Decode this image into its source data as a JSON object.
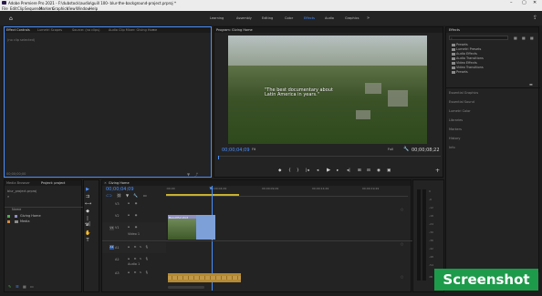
{
  "window": {
    "title": "Adobe Premiere Pro 2021 - F:\\dubstock\\audio\\guill 100- blur-the-background-project.prproj *",
    "controls": [
      "–",
      "▢",
      "✕"
    ]
  },
  "menu": [
    "File",
    "Edit",
    "Clip",
    "Sequence",
    "Markers",
    "Graphics",
    "View",
    "Window",
    "Help"
  ],
  "workspaces": {
    "tabs": [
      "Learning",
      "Assembly",
      "Editing",
      "Color",
      "Effects",
      "Audio",
      "Graphics"
    ],
    "active": "Effects",
    "menu_icon": "»"
  },
  "effect_controls": {
    "tabs": [
      "Effect Controls",
      "Lumetri Scopes",
      "Source: (no clips)",
      "Audio Clip Mixer: Giving Home"
    ],
    "no_clip": "(no clip selected)",
    "timecode": "00;00;00;00"
  },
  "program": {
    "title": "Program: Giving Home",
    "caption_line1": "\"The best documentary about",
    "caption_line2": "Latin America in years.\"",
    "timecode_current": "00;00;04;09",
    "fit": "Fit",
    "quality": "Full",
    "timecode_duration": "00;00;08;22"
  },
  "transport": [
    "◆",
    "{",
    "}",
    "|◂",
    "◂|",
    "◂",
    "▶",
    "▸",
    "|▸",
    "⊞",
    "⊟",
    "◉",
    "▣"
  ],
  "effects_panel": {
    "title": "Effects",
    "items": [
      "Presets",
      "Lumetri Presets",
      "Audio Effects",
      "Audio Transitions",
      "Video Effects",
      "Video Transitions",
      "Presets"
    ],
    "sections": [
      "Essential Graphics",
      "Essential Sound",
      "Lumetri Color",
      "Libraries",
      "Markers",
      "History",
      "Info"
    ]
  },
  "project": {
    "tabs": [
      "Media Browser",
      "Project: project"
    ],
    "file": "blur_project.prproj",
    "column": "Name",
    "items": [
      "Giving Home",
      "Media"
    ]
  },
  "timeline": {
    "sequence": "Giving Home",
    "timecode": "00;00;04;09",
    "ruler": [
      ":00;00",
      "00;00;04;29",
      "00;00;09;29",
      "00;00;14;29",
      "00;00;19;29"
    ],
    "video_tracks": [
      "V3",
      "V2",
      "V1"
    ],
    "audio_tracks": [
      "A1",
      "A2",
      "A3"
    ],
    "track_names": {
      "V1": "Video 1",
      "A1": "Audio 1"
    },
    "clip_label": "Beautiful shot",
    "buttons": [
      "M",
      "S"
    ]
  },
  "meter": {
    "ticks": [
      "0",
      "-6",
      "-12",
      "-18",
      "-24",
      "-30",
      "-36",
      "-42",
      "-48",
      "-54",
      "dB"
    ]
  },
  "watermark": "Screenshot",
  "colors": {
    "accent": "#4a8ffc",
    "video_clip": "#8f8fc8",
    "audio_clip": "#b38a33",
    "badge": "#1d9a4a"
  }
}
